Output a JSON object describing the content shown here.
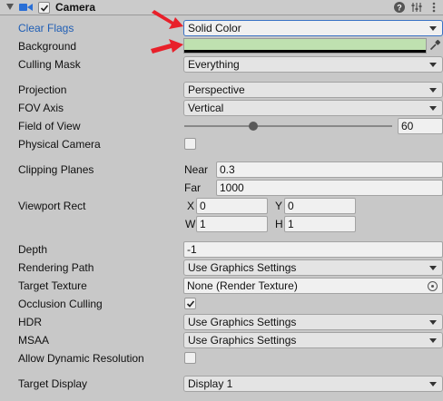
{
  "header": {
    "title": "Camera",
    "enabled": true
  },
  "clear_flags": {
    "label": "Clear Flags",
    "value": "Solid Color"
  },
  "background": {
    "label": "Background",
    "color": "#bfe1b0"
  },
  "culling_mask": {
    "label": "Culling Mask",
    "value": "Everything"
  },
  "projection": {
    "label": "Projection",
    "value": "Perspective"
  },
  "fov_axis": {
    "label": "FOV Axis",
    "value": "Vertical"
  },
  "field_of_view": {
    "label": "Field of View",
    "value": "60",
    "slider_fraction": 0.33
  },
  "physical_camera": {
    "label": "Physical Camera",
    "checked": false
  },
  "clipping_planes": {
    "label": "Clipping Planes",
    "near_label": "Near",
    "near": "0.3",
    "far_label": "Far",
    "far": "1000"
  },
  "viewport_rect": {
    "label": "Viewport Rect",
    "x_label": "X",
    "x": "0",
    "y_label": "Y",
    "y": "0",
    "w_label": "W",
    "w": "1",
    "h_label": "H",
    "h": "1"
  },
  "depth": {
    "label": "Depth",
    "value": "-1"
  },
  "rendering_path": {
    "label": "Rendering Path",
    "value": "Use Graphics Settings"
  },
  "target_texture": {
    "label": "Target Texture",
    "value": "None (Render Texture)"
  },
  "occlusion_culling": {
    "label": "Occlusion Culling",
    "checked": true
  },
  "hdr": {
    "label": "HDR",
    "value": "Use Graphics Settings"
  },
  "msaa": {
    "label": "MSAA",
    "value": "Use Graphics Settings"
  },
  "allow_dynamic_resolution": {
    "label": "Allow Dynamic Resolution",
    "checked": false
  },
  "target_display": {
    "label": "Target Display",
    "value": "Display 1"
  },
  "colors": {
    "accent_blue": "#1f5eb5",
    "annotation_red": "#e8202a"
  }
}
